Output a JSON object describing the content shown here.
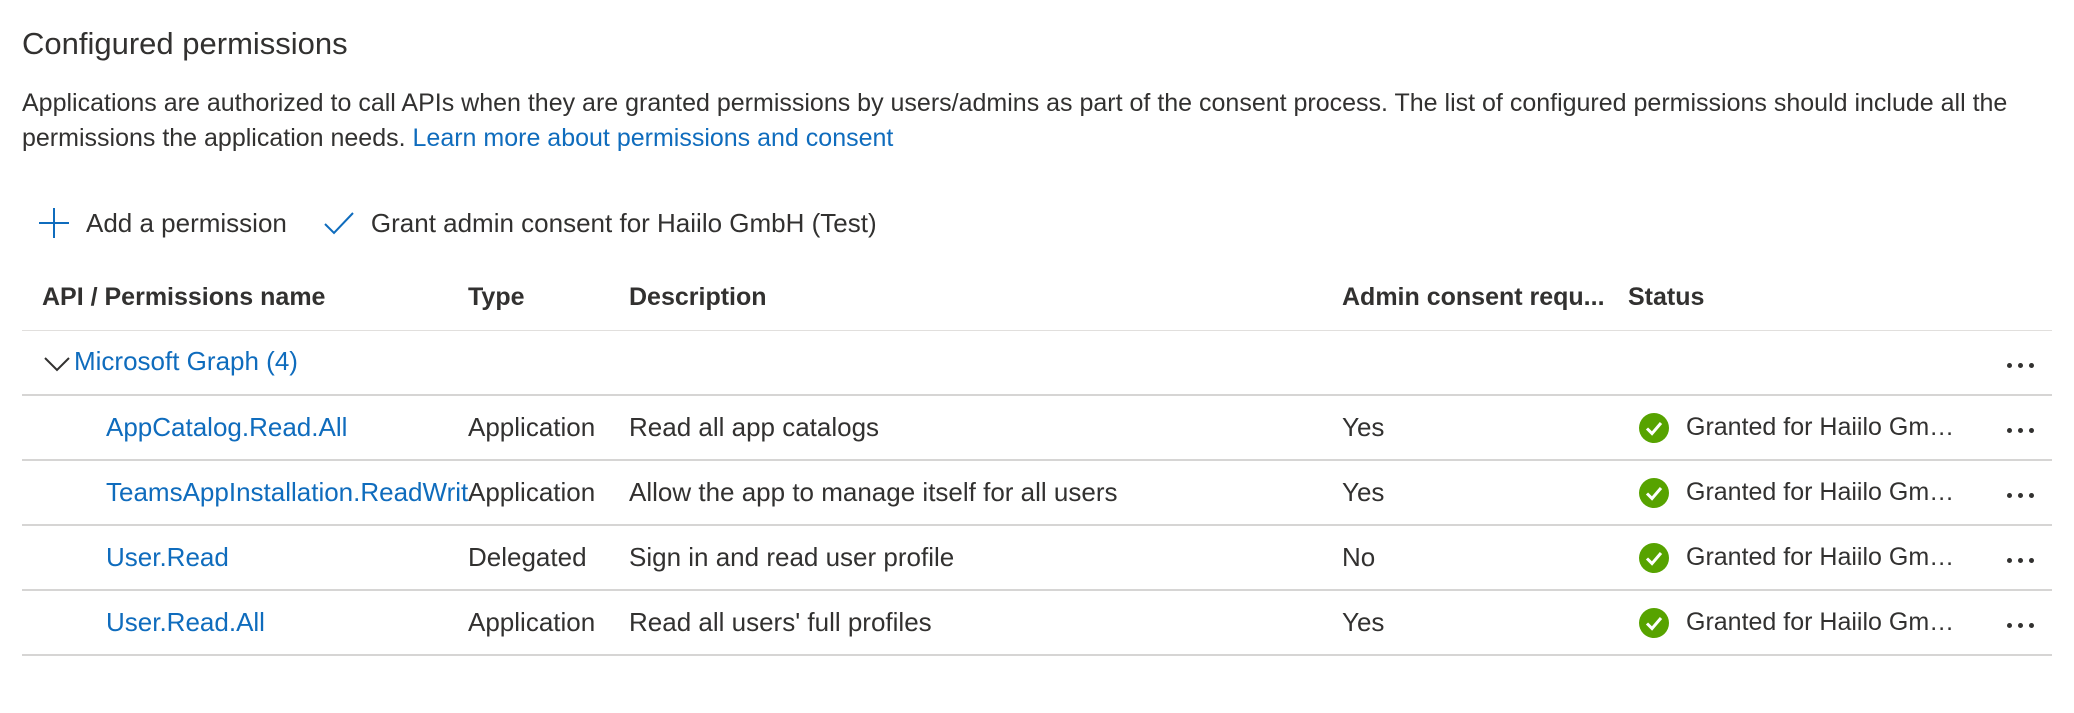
{
  "header": {
    "title": "Configured permissions",
    "description": "Applications are authorized to call APIs when they are granted permissions by users/admins as part of the consent process. The list of configured permissions should include all the permissions the application needs. ",
    "learn_more_link": "Learn more about permissions and consent"
  },
  "toolbar": {
    "add_label": "Add a permission",
    "grant_label": "Grant admin consent for Haiilo GmbH (Test)"
  },
  "table": {
    "columns": {
      "name": "API / Permissions name",
      "type": "Type",
      "description": "Description",
      "admin_consent": "Admin consent requ...",
      "status": "Status"
    },
    "group": {
      "label": "Microsoft Graph (4)"
    },
    "rows": [
      {
        "name": "AppCatalog.Read.All",
        "type": "Application",
        "description": "Read all app catalogs",
        "admin_consent": "Yes",
        "status": "Granted for Haiilo GmbH (Test)"
      },
      {
        "name": "TeamsAppInstallation.ReadWriteSelfForUser.All",
        "type": "Application",
        "description": "Allow the app to manage itself for all users",
        "admin_consent": "Yes",
        "status": "Granted for Haiilo GmbH (Test)"
      },
      {
        "name": "User.Read",
        "type": "Delegated",
        "description": "Sign in and read user profile",
        "admin_consent": "No",
        "status": "Granted for Haiilo GmbH (Test)"
      },
      {
        "name": "User.Read.All",
        "type": "Application",
        "description": "Read all users' full profiles",
        "admin_consent": "Yes",
        "status": "Granted for Haiilo GmbH (Test)"
      }
    ]
  },
  "icons": {
    "add": "plus-icon",
    "grant": "checkmark-icon",
    "status": "check-circle-icon",
    "expand": "chevron-down-icon",
    "more": "more-horizontal-icon"
  },
  "colors": {
    "link": "#0f6cbd",
    "text": "#323130",
    "success": "#57a300",
    "divider": "#d6d5d4"
  }
}
